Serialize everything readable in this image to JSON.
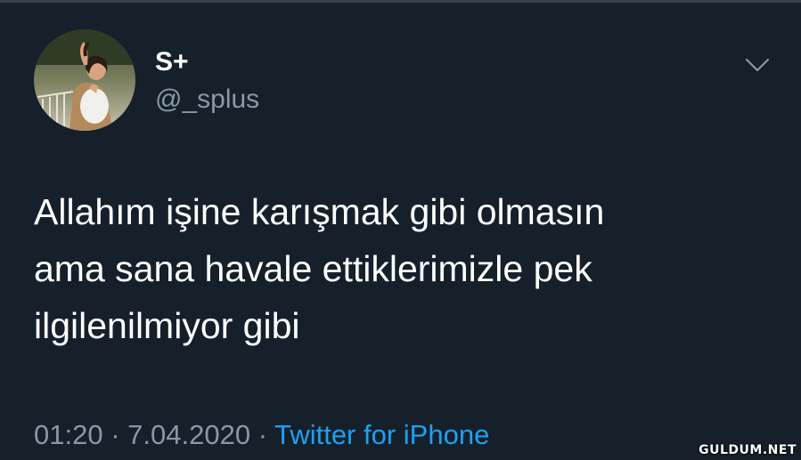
{
  "user": {
    "display_name": "S+",
    "handle": "@_splus"
  },
  "tweet": {
    "lines": [
      "Allahım işine karışmak gibi olmasın",
      "ama sana havale ettiklerimizle pek",
      "ilgilenilmiyor gibi"
    ]
  },
  "meta": {
    "time": "01:20",
    "separator": "·",
    "date": "7.04.2020",
    "source": "Twitter for iPhone"
  },
  "watermark": "GULDUM.NET",
  "icons": {
    "caret": "chevron-down-icon",
    "avatar": "profile-photo"
  },
  "colors": {
    "background": "#15202b",
    "secondary_text": "#8899a6",
    "link": "#1da1f2"
  }
}
